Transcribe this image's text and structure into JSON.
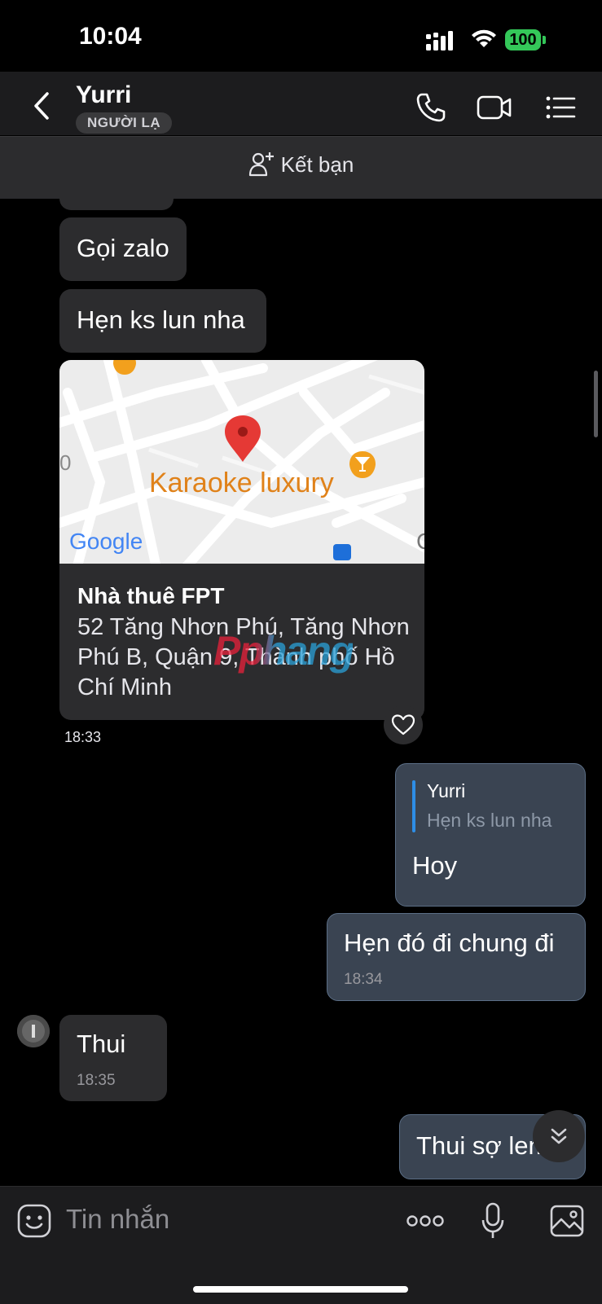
{
  "status": {
    "time": "10:04",
    "battery": "100"
  },
  "header": {
    "name": "Yurri",
    "badge": "NGƯỜI LẠ"
  },
  "friend_bar": {
    "label": "Kết bạn"
  },
  "messages": {
    "m1": "Gọi zalo",
    "m2": "Hẹn ks lun nha",
    "location": {
      "map_place": "Karaoke luxury",
      "map_brand": "Google",
      "title": "Nhà thuê FPT",
      "address": "52 Tăng Nhơn Phú, Tăng Nhơn Phú B, Quận 9, Thành phố Hồ Chí Minh",
      "time": "18:33"
    },
    "reply": {
      "quoted_name": "Yurri",
      "quoted_text": "Hẹn ks lun nha",
      "text": "Hoy"
    },
    "m3": {
      "text": "Hẹn đó đi chung đi",
      "time": "18:34"
    },
    "m4": {
      "text": "Thui",
      "time": "18:35"
    },
    "m5": {
      "text": "Thui sợ lem"
    }
  },
  "watermark": "Pphang",
  "input": {
    "placeholder": "Tin nhắn"
  },
  "colors": {
    "accent": "#2e8ee6",
    "battery": "#34c759",
    "pin": "#e53935",
    "karaoke": "#e0821a"
  }
}
